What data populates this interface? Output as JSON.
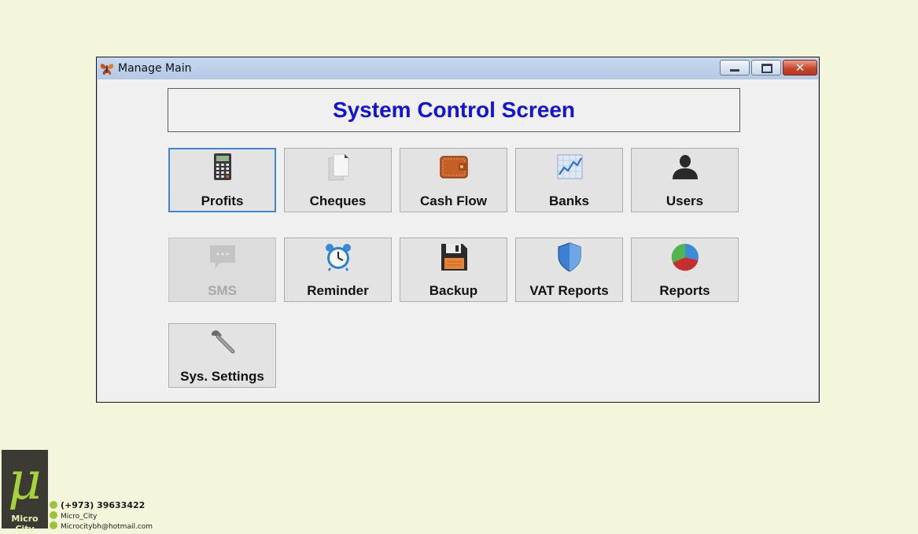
{
  "window": {
    "title": "Manage Main",
    "controls": {
      "minimize": "minimize",
      "maximize": "maximize",
      "close": "✕"
    }
  },
  "header": {
    "title": "System Control Screen"
  },
  "tiles": [
    {
      "label": "Profits",
      "icon": "calculator-icon",
      "state": "focused"
    },
    {
      "label": "Cheques",
      "icon": "documents-icon",
      "state": "normal"
    },
    {
      "label": "Cash Flow",
      "icon": "wallet-icon",
      "state": "normal"
    },
    {
      "label": "Banks",
      "icon": "chart-icon",
      "state": "normal"
    },
    {
      "label": "Users",
      "icon": "user-icon",
      "state": "normal"
    },
    {
      "label": "SMS",
      "icon": "message-icon",
      "state": "disabled"
    },
    {
      "label": "Reminder",
      "icon": "alarm-clock-icon",
      "state": "normal"
    },
    {
      "label": "Backup",
      "icon": "floppy-disk-icon",
      "state": "normal"
    },
    {
      "label": "VAT Reports",
      "icon": "shield-icon",
      "state": "normal"
    },
    {
      "label": "Reports",
      "icon": "pie-chart-icon",
      "state": "normal"
    },
    {
      "label": "Sys. Settings",
      "icon": "wrench-icon",
      "state": "normal"
    }
  ],
  "branding": {
    "logo_symbol": "μ",
    "logo_name": "Micro City",
    "phone": "(+973) 39633422",
    "instagram": "Micro_City",
    "email": "Microcitybh@hotmail.com"
  },
  "colors": {
    "background": "#f3f6db",
    "title_accent": "#1111e0",
    "focus_border": "#3f86d3",
    "logo_green": "#a6d23d"
  }
}
